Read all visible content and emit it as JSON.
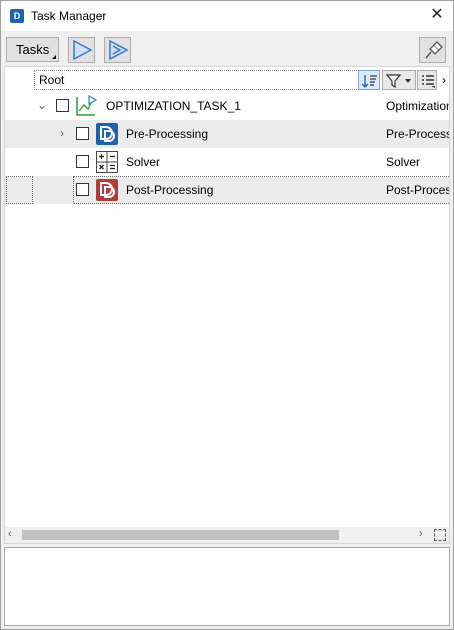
{
  "window": {
    "title": "Task Manager",
    "close_glyph": "✕",
    "app_icon": "app-logo-icon"
  },
  "toolbar": {
    "tasks_label": "Tasks",
    "buttons": [
      {
        "name": "run",
        "icon": "play-icon"
      },
      {
        "name": "run-step",
        "icon": "play-step-icon"
      },
      {
        "name": "pin",
        "icon": "pin-icon"
      }
    ]
  },
  "tree": {
    "root_label": "Root",
    "header_more_glyph": "›",
    "rows": [
      {
        "expander": "⌄",
        "label": "OPTIMIZATION_TASK_1",
        "type": "Optimization",
        "icon": "optimization-icon",
        "checked": false
      },
      {
        "expander": "›",
        "label": "Pre-Processing",
        "type": "Pre-Processing",
        "icon": "pre-processing-icon",
        "checked": false
      },
      {
        "expander": "",
        "label": "Solver",
        "type": "Solver",
        "icon": "solver-icon",
        "checked": false
      },
      {
        "expander": "",
        "label": "Post-Processing",
        "type": "Post-Processing",
        "icon": "post-processing-icon",
        "checked": false
      }
    ]
  },
  "scrollbar": {
    "left_glyph": "‹",
    "right_glyph": "›"
  },
  "colors": {
    "accent_blue": "#1d63b0",
    "post_red": "#b53a3a",
    "opt_green": "#2e9b3e",
    "row_alt": "#ececec"
  }
}
